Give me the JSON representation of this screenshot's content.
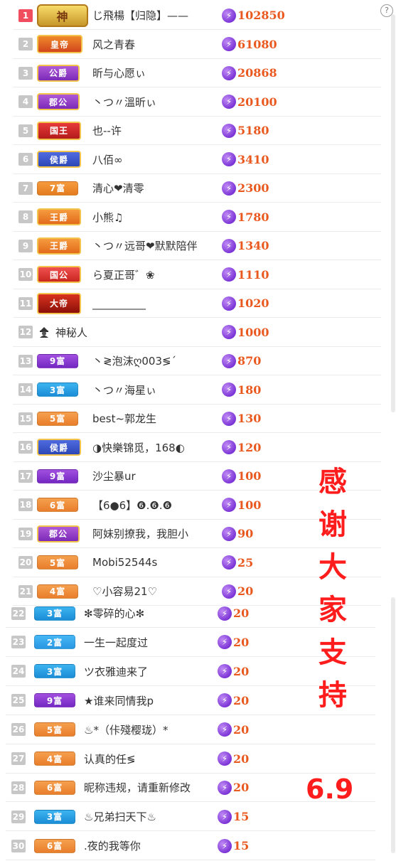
{
  "help_label": "?",
  "thanks": [
    "感",
    "谢",
    "大",
    "家",
    "支",
    "持"
  ],
  "version": "6.9",
  "rows": [
    {
      "rank": "1",
      "badge": "神",
      "type": "god",
      "name": "じ飛楊【归隐】——",
      "value": "102850"
    },
    {
      "rank": "2",
      "badge": "皇帝",
      "type": "emperor",
      "name": "风之青春",
      "value": "61080"
    },
    {
      "rank": "3",
      "badge": "公爵",
      "type": "duke",
      "name": "昕与心愿ぃ",
      "value": "20868"
    },
    {
      "rank": "4",
      "badge": "郡公",
      "type": "duke",
      "name": "丶つ〃溫昕ぃ",
      "value": "20100"
    },
    {
      "rank": "5",
      "badge": "国王",
      "type": "king",
      "name": "也--许",
      "value": "5180"
    },
    {
      "rank": "6",
      "badge": "侯爵",
      "type": "marquis",
      "name": "八佰∞",
      "value": "3410"
    },
    {
      "rank": "7",
      "badge": "7富",
      "type": "rich7",
      "name": "清心❤清零",
      "value": "2300"
    },
    {
      "rank": "8",
      "badge": "王爵",
      "type": "wang",
      "name": "小熊♫",
      "value": "1780"
    },
    {
      "rank": "9",
      "badge": "王爵",
      "type": "wang",
      "name": "丶つ〃远哥❤默默陪伴",
      "value": "1340"
    },
    {
      "rank": "10",
      "badge": "国公",
      "type": "guogong",
      "name": "ら夏正哥゛❀",
      "value": "1110"
    },
    {
      "rank": "11",
      "badge": "大帝",
      "type": "dadi",
      "name": "__________",
      "value": "1020"
    },
    {
      "rank": "12",
      "badge": "",
      "type": "mystery",
      "name": "神秘人",
      "value": "1000"
    },
    {
      "rank": "13",
      "badge": "9富",
      "type": "rich9",
      "name": "丶≷泡沫ღ003≶ˊ",
      "value": "870"
    },
    {
      "rank": "14",
      "badge": "3富",
      "type": "rich3",
      "name": "丶つ〃海星ぃ",
      "value": "180"
    },
    {
      "rank": "15",
      "badge": "5富",
      "type": "rich5",
      "name": "best~郭龙生",
      "value": "130"
    },
    {
      "rank": "16",
      "badge": "侯爵",
      "type": "marquis",
      "name": "◑快樂锦觅，168◐",
      "value": "120"
    },
    {
      "rank": "17",
      "badge": "9富",
      "type": "rich9",
      "name": "沙尘暴ur",
      "value": "100"
    },
    {
      "rank": "18",
      "badge": "6富",
      "type": "rich6",
      "name": "【6●6】❻.❻.❻",
      "value": "100"
    },
    {
      "rank": "19",
      "badge": "郡公",
      "type": "duke",
      "name": "阿妹别撩我，我胆小",
      "value": "90"
    },
    {
      "rank": "20",
      "badge": "5富",
      "type": "rich5",
      "name": "Mobi52544s",
      "value": "25"
    },
    {
      "rank": "21",
      "badge": "4富",
      "type": "rich4",
      "name": "♡小容易21♡",
      "value": "20"
    },
    {
      "rank": "22",
      "badge": "3富",
      "type": "rich3",
      "name": "✻零碎的心✻",
      "value": "20"
    },
    {
      "rank": "23",
      "badge": "2富",
      "type": "rich2",
      "name": "一生一起度过",
      "value": "20"
    },
    {
      "rank": "24",
      "badge": "3富",
      "type": "rich3",
      "name": "ツ衣雅迪来了",
      "value": "20"
    },
    {
      "rank": "25",
      "badge": "9富",
      "type": "rich9",
      "name": "★谁来同情我p",
      "value": "20"
    },
    {
      "rank": "26",
      "badge": "5富",
      "type": "rich5",
      "name": "♨*（佧殘樱珑）*",
      "value": "20"
    },
    {
      "rank": "27",
      "badge": "4富",
      "type": "rich4",
      "name": "认真的任≶",
      "value": "20"
    },
    {
      "rank": "28",
      "badge": "6富",
      "type": "rich6",
      "name": "昵称违规，请重新修改",
      "value": "20"
    },
    {
      "rank": "29",
      "badge": "3富",
      "type": "rich3",
      "name": "♨兄弟扫天下♨",
      "value": "15"
    },
    {
      "rank": "30",
      "badge": "6富",
      "type": "rich6",
      "name": ".夜的我等你",
      "value": "15"
    }
  ]
}
